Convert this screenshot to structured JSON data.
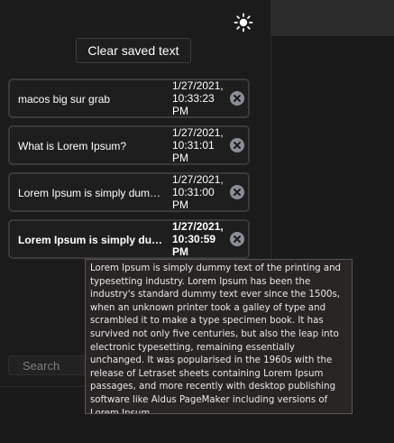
{
  "header": {
    "theme_toggle_icon": "sun-icon"
  },
  "toolbar": {
    "clear_label": "Clear saved text"
  },
  "entries": [
    {
      "text": "macos big sur grab",
      "time": "1/27/2021, 10:33:23 PM",
      "bold": false
    },
    {
      "text": "What is Lorem Ipsum?",
      "time": "1/27/2021, 10:31:01 PM",
      "bold": false
    },
    {
      "text": "Lorem Ipsum is simply dummy text of the printing and typesetting industry.",
      "time": "1/27/2021, 10:31:00 PM",
      "bold": false
    },
    {
      "text": "Lorem Ipsum is simply dummy text of the printing and typesetting industry.",
      "time": "1/27/2021, 10:30:59 PM",
      "bold": true
    }
  ],
  "search": {
    "placeholder": "Search",
    "value": ""
  },
  "tooltip": {
    "text": "Lorem Ipsum is simply dummy text of the printing and typesetting industry. Lorem Ipsum has been the industry's standard dummy text ever since the 1500s, when an unknown printer took a galley of type and scrambled it to make a type specimen book. It has survived not only five centuries, but also the leap into electronic typesetting, remaining essentially unchanged. It was popularised in the 1960s with the release of Letraset sheets containing Lorem Ipsum passages, and more recently with desktop publishing software like Aldus PageMaker including versions of Lorem Ipsum."
  },
  "colors": {
    "background": "#1b1b1b",
    "card_border": "#3a3a3a",
    "delete_icon": "#8a8e96",
    "tooltip_bg": "#2a2525"
  }
}
